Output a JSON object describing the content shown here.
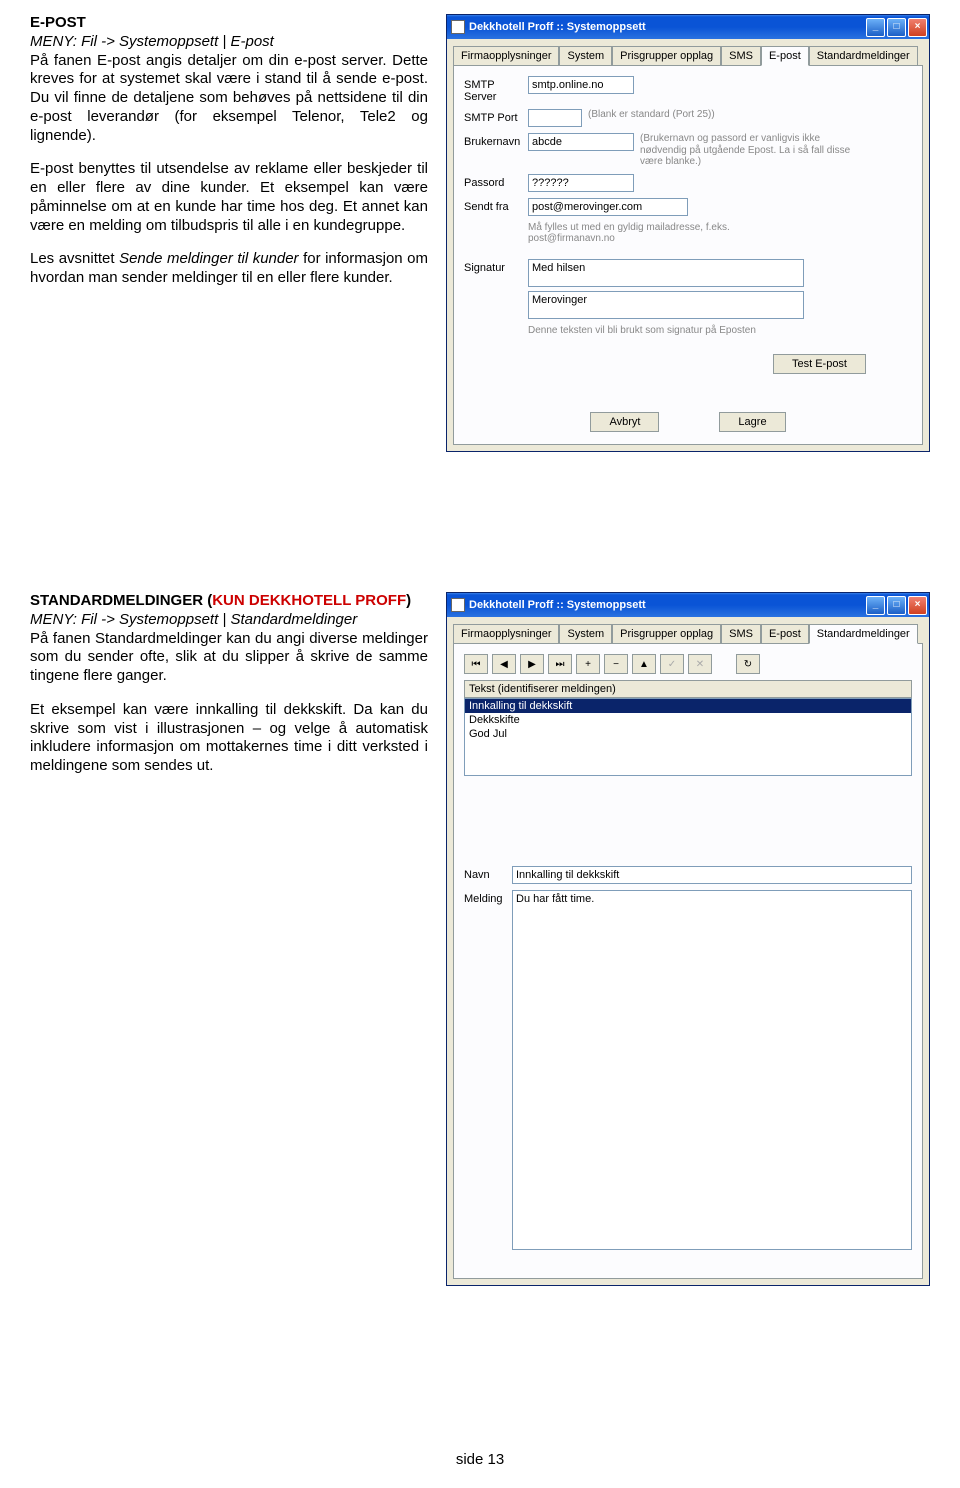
{
  "section1": {
    "title": "E-POST",
    "menu_prefix": "MENY: Fil -> Systemoppsett | E-post",
    "p1": "På fanen E-post angis detaljer om din e-post server. Dette kreves for at systemet skal være i stand til å sende e-post. Du vil finne de detaljene som behøves på nettsidene til din e-post leverandør (for eksempel Telenor, Tele2 og lignende).",
    "p2": "E-post benyttes til utsendelse av reklame eller beskjeder til en eller flere av dine kunder. Et eksempel kan være påminnelse om at en kunde har time hos deg. Et annet kan være en melding om tilbudspris til alle i en kundegruppe.",
    "p3a": "Les avsnittet ",
    "p3b": "Sende meldinger til kunder",
    "p3c": " for informasjon om hvordan man sender meldinger til en eller flere kunder."
  },
  "window1": {
    "title": "Dekkhotell Proff  ::  Systemoppsett",
    "tabs": [
      "Firmaopplysninger",
      "System",
      "Prisgrupper opplag",
      "SMS",
      "E-post",
      "Standardmeldinger"
    ],
    "active_tab": 4,
    "labels": {
      "smtp_server": "SMTP Server",
      "smtp_port": "SMTP Port",
      "user": "Brukernavn",
      "pass": "Passord",
      "from": "Sendt fra",
      "signature": "Signatur"
    },
    "values": {
      "smtp_server": "smtp.online.no",
      "smtp_port": "",
      "user": "abcde",
      "pass": "??????",
      "from": "post@merovinger.com",
      "sig1": "Med hilsen",
      "sig2": "Merovinger"
    },
    "hints": {
      "port": "(Blank er standard (Port 25))",
      "user": "(Brukernavn og passord er vanligvis ikke nødvendig på utgående Epost. La i så fall disse være blanke.)",
      "from": "Må fylles ut med en gyldig mailadresse, f.eks.  post@firmanavn.no",
      "sig": "Denne teksten vil bli brukt som signatur på Eposten"
    },
    "btn_test": "Test E-post",
    "btn_cancel": "Avbryt",
    "btn_save": "Lagre"
  },
  "section2": {
    "title_a": "STANDARDMELDINGER (",
    "title_b": "KUN DEKKHOTELL PROFF",
    "title_c": ")",
    "menu_prefix": "MENY: Fil -> Systemoppsett | Standardmeldinger",
    "p1": "På fanen Standardmeldinger kan du angi diverse meldinger som du sender ofte, slik at du slipper å skrive de samme tingene flere ganger.",
    "p2": "Et eksempel kan være innkalling til dekkskift. Da kan du skrive som vist i illustrasjonen – og velge å automatisk inkludere informasjon om mottakernes time i ditt verksted i meldingene som sendes ut."
  },
  "window2": {
    "title": "Dekkhotell Proff  ::  Systemoppsett",
    "tabs": [
      "Firmaopplysninger",
      "System",
      "Prisgrupper opplag",
      "SMS",
      "E-post",
      "Standardmeldinger"
    ],
    "active_tab": 5,
    "list_header": "Tekst (identifiserer meldingen)",
    "list_items": [
      "Innkalling til dekkskift",
      "Dekkskifte",
      "God Jul"
    ],
    "selected": 0,
    "label_name": "Navn",
    "label_msg": "Melding",
    "name_value": "Innkalling til dekkskift",
    "msg_value": "Du har fått time."
  },
  "footer": "side  13"
}
